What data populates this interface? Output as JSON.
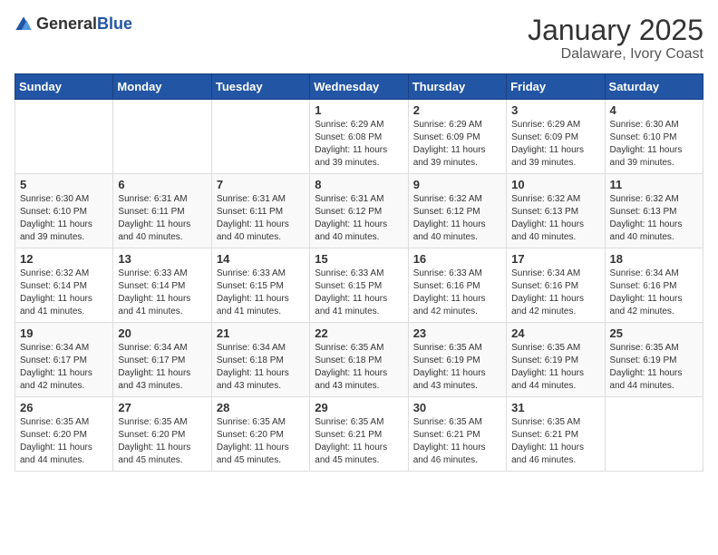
{
  "header": {
    "logo": {
      "general": "General",
      "blue": "Blue"
    },
    "title": "January 2025",
    "subtitle": "Dalaware, Ivory Coast"
  },
  "calendar": {
    "weekdays": [
      "Sunday",
      "Monday",
      "Tuesday",
      "Wednesday",
      "Thursday",
      "Friday",
      "Saturday"
    ],
    "weeks": [
      [
        {
          "day": "",
          "info": ""
        },
        {
          "day": "",
          "info": ""
        },
        {
          "day": "",
          "info": ""
        },
        {
          "day": "1",
          "info": "Sunrise: 6:29 AM\nSunset: 6:08 PM\nDaylight: 11 hours and 39 minutes."
        },
        {
          "day": "2",
          "info": "Sunrise: 6:29 AM\nSunset: 6:09 PM\nDaylight: 11 hours and 39 minutes."
        },
        {
          "day": "3",
          "info": "Sunrise: 6:29 AM\nSunset: 6:09 PM\nDaylight: 11 hours and 39 minutes."
        },
        {
          "day": "4",
          "info": "Sunrise: 6:30 AM\nSunset: 6:10 PM\nDaylight: 11 hours and 39 minutes."
        }
      ],
      [
        {
          "day": "5",
          "info": "Sunrise: 6:30 AM\nSunset: 6:10 PM\nDaylight: 11 hours and 39 minutes."
        },
        {
          "day": "6",
          "info": "Sunrise: 6:31 AM\nSunset: 6:11 PM\nDaylight: 11 hours and 40 minutes."
        },
        {
          "day": "7",
          "info": "Sunrise: 6:31 AM\nSunset: 6:11 PM\nDaylight: 11 hours and 40 minutes."
        },
        {
          "day": "8",
          "info": "Sunrise: 6:31 AM\nSunset: 6:12 PM\nDaylight: 11 hours and 40 minutes."
        },
        {
          "day": "9",
          "info": "Sunrise: 6:32 AM\nSunset: 6:12 PM\nDaylight: 11 hours and 40 minutes."
        },
        {
          "day": "10",
          "info": "Sunrise: 6:32 AM\nSunset: 6:13 PM\nDaylight: 11 hours and 40 minutes."
        },
        {
          "day": "11",
          "info": "Sunrise: 6:32 AM\nSunset: 6:13 PM\nDaylight: 11 hours and 40 minutes."
        }
      ],
      [
        {
          "day": "12",
          "info": "Sunrise: 6:32 AM\nSunset: 6:14 PM\nDaylight: 11 hours and 41 minutes."
        },
        {
          "day": "13",
          "info": "Sunrise: 6:33 AM\nSunset: 6:14 PM\nDaylight: 11 hours and 41 minutes."
        },
        {
          "day": "14",
          "info": "Sunrise: 6:33 AM\nSunset: 6:15 PM\nDaylight: 11 hours and 41 minutes."
        },
        {
          "day": "15",
          "info": "Sunrise: 6:33 AM\nSunset: 6:15 PM\nDaylight: 11 hours and 41 minutes."
        },
        {
          "day": "16",
          "info": "Sunrise: 6:33 AM\nSunset: 6:16 PM\nDaylight: 11 hours and 42 minutes."
        },
        {
          "day": "17",
          "info": "Sunrise: 6:34 AM\nSunset: 6:16 PM\nDaylight: 11 hours and 42 minutes."
        },
        {
          "day": "18",
          "info": "Sunrise: 6:34 AM\nSunset: 6:16 PM\nDaylight: 11 hours and 42 minutes."
        }
      ],
      [
        {
          "day": "19",
          "info": "Sunrise: 6:34 AM\nSunset: 6:17 PM\nDaylight: 11 hours and 42 minutes."
        },
        {
          "day": "20",
          "info": "Sunrise: 6:34 AM\nSunset: 6:17 PM\nDaylight: 11 hours and 43 minutes."
        },
        {
          "day": "21",
          "info": "Sunrise: 6:34 AM\nSunset: 6:18 PM\nDaylight: 11 hours and 43 minutes."
        },
        {
          "day": "22",
          "info": "Sunrise: 6:35 AM\nSunset: 6:18 PM\nDaylight: 11 hours and 43 minutes."
        },
        {
          "day": "23",
          "info": "Sunrise: 6:35 AM\nSunset: 6:19 PM\nDaylight: 11 hours and 43 minutes."
        },
        {
          "day": "24",
          "info": "Sunrise: 6:35 AM\nSunset: 6:19 PM\nDaylight: 11 hours and 44 minutes."
        },
        {
          "day": "25",
          "info": "Sunrise: 6:35 AM\nSunset: 6:19 PM\nDaylight: 11 hours and 44 minutes."
        }
      ],
      [
        {
          "day": "26",
          "info": "Sunrise: 6:35 AM\nSunset: 6:20 PM\nDaylight: 11 hours and 44 minutes."
        },
        {
          "day": "27",
          "info": "Sunrise: 6:35 AM\nSunset: 6:20 PM\nDaylight: 11 hours and 45 minutes."
        },
        {
          "day": "28",
          "info": "Sunrise: 6:35 AM\nSunset: 6:20 PM\nDaylight: 11 hours and 45 minutes."
        },
        {
          "day": "29",
          "info": "Sunrise: 6:35 AM\nSunset: 6:21 PM\nDaylight: 11 hours and 45 minutes."
        },
        {
          "day": "30",
          "info": "Sunrise: 6:35 AM\nSunset: 6:21 PM\nDaylight: 11 hours and 46 minutes."
        },
        {
          "day": "31",
          "info": "Sunrise: 6:35 AM\nSunset: 6:21 PM\nDaylight: 11 hours and 46 minutes."
        },
        {
          "day": "",
          "info": ""
        }
      ]
    ]
  }
}
